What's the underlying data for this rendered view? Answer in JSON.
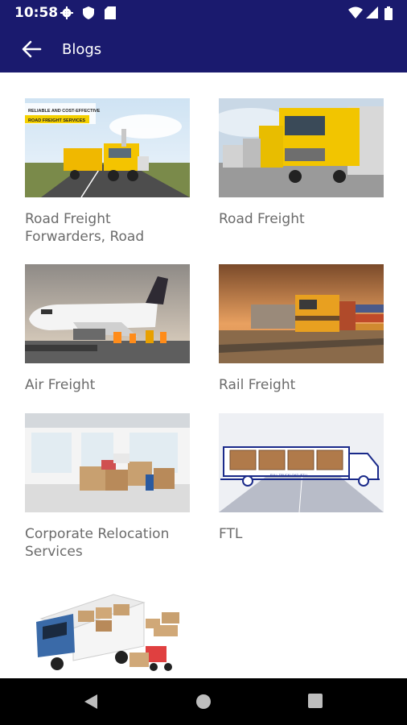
{
  "status": {
    "time": "10:58"
  },
  "appbar": {
    "title": "Blogs"
  },
  "posts": [
    {
      "label": "Road Freight Forwarders, Road",
      "banner_line1": "RELIABLE AND COST-EFFECTIVE",
      "banner_line2": "ROAD FREIGHT SERVICES"
    },
    {
      "label": "Road Freight"
    },
    {
      "label": "Air Freight"
    },
    {
      "label": "Rail Freight"
    },
    {
      "label": "Corporate Relocation Services"
    },
    {
      "label": "FTL",
      "truck_text": "FULL TRUCKLOAD (FTL)"
    },
    {
      "label": ""
    }
  ],
  "colors": {
    "primary": "#1a1a6e",
    "label": "#6b6b6b",
    "nav": "#000000"
  },
  "icons": [
    "back-arrow-icon",
    "settings-icon",
    "shield-icon",
    "sd-card-icon",
    "wifi-icon",
    "signal-icon",
    "battery-icon",
    "nav-back-icon",
    "nav-home-icon",
    "nav-recents-icon"
  ]
}
